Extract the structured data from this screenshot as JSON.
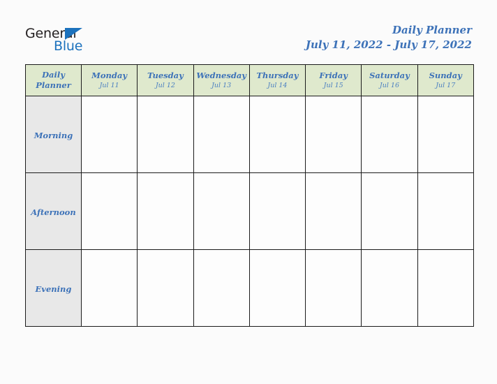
{
  "colors": {
    "accent_blue": "#3d72b8",
    "logo_blue": "#1c72bd",
    "logo_dark": "#231f20",
    "header_green": "#dfe9cd",
    "row_label_gray": "#e8e8e8",
    "grid_line": "#1b1b1b",
    "page_background": "#fbfbfb"
  },
  "logo": {
    "word_one": "General",
    "word_two": "Blue",
    "mark": "triangle-icon"
  },
  "header": {
    "title": "Daily Planner",
    "date_range": "July 11, 2022 - July 17, 2022"
  },
  "table": {
    "corner": {
      "line1": "Daily",
      "line2": "Planner"
    },
    "days": [
      {
        "name": "Monday",
        "date": "Jul 11"
      },
      {
        "name": "Tuesday",
        "date": "Jul 12"
      },
      {
        "name": "Wednesday",
        "date": "Jul 13"
      },
      {
        "name": "Thursday",
        "date": "Jul 14"
      },
      {
        "name": "Friday",
        "date": "Jul 15"
      },
      {
        "name": "Saturday",
        "date": "Jul 16"
      },
      {
        "name": "Sunday",
        "date": "Jul 17"
      }
    ],
    "rows": [
      {
        "label": "Morning",
        "cells": [
          "",
          "",
          "",
          "",
          "",
          "",
          ""
        ]
      },
      {
        "label": "Afternoon",
        "cells": [
          "",
          "",
          "",
          "",
          "",
          "",
          ""
        ]
      },
      {
        "label": "Evening",
        "cells": [
          "",
          "",
          "",
          "",
          "",
          "",
          ""
        ]
      }
    ]
  }
}
